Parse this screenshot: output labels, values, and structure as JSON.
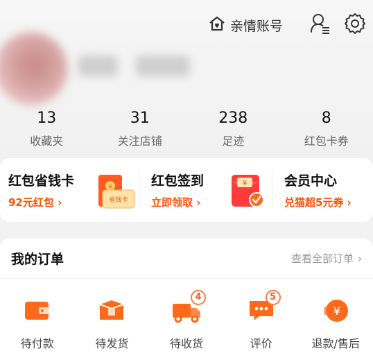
{
  "header": {
    "family_account_label": "亲情账号",
    "stats": [
      {
        "value": "13",
        "label": "收藏夹"
      },
      {
        "value": "31",
        "label": "关注店铺"
      },
      {
        "value": "238",
        "label": "足迹"
      },
      {
        "value": "8",
        "label": "红包卡券"
      }
    ]
  },
  "promo": {
    "items": [
      {
        "title": "红包省钱卡",
        "subtitle": "92元红包 ›",
        "card_text": "省钱卡"
      },
      {
        "title": "红包签到",
        "subtitle": "立即领取 ›",
        "envelope_symbol": "¥"
      },
      {
        "title": "会员中心",
        "subtitle": "兑猫超5元券 ›"
      }
    ]
  },
  "orders": {
    "title": "我的订单",
    "view_all": "查看全部订单",
    "view_all_chevron": "›",
    "items": [
      {
        "label": "待付款",
        "icon": "wallet-icon",
        "badge": ""
      },
      {
        "label": "待发货",
        "icon": "package-icon",
        "badge": ""
      },
      {
        "label": "待收货",
        "icon": "truck-icon",
        "badge": "4"
      },
      {
        "label": "评价",
        "icon": "comment-icon",
        "badge": "5"
      },
      {
        "label": "退款/售后",
        "icon": "refund-icon",
        "badge": ""
      }
    ]
  },
  "colors": {
    "accent": "#ff5000",
    "icon_orange": "#ff6a1a",
    "background": "#f2f2f2"
  }
}
